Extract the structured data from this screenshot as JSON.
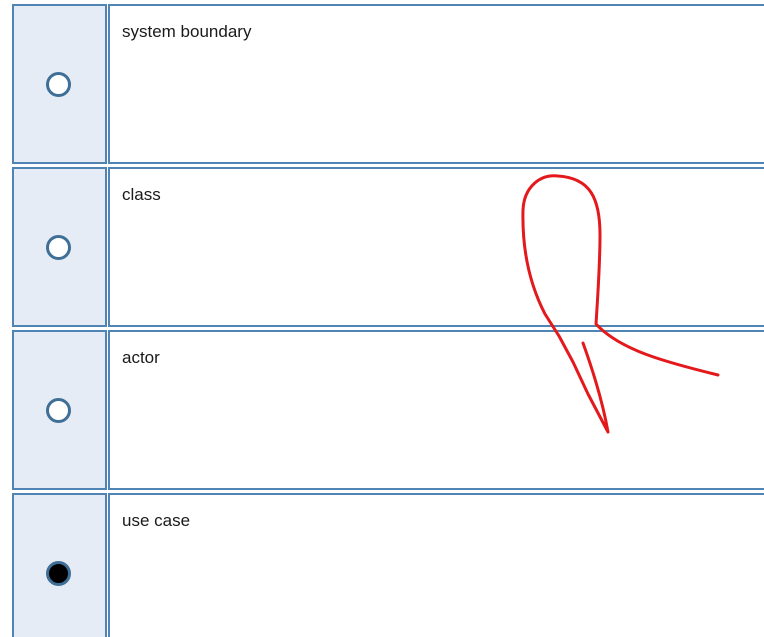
{
  "question": {
    "options": [
      {
        "label": "system boundary",
        "selected": false
      },
      {
        "label": "class",
        "selected": false
      },
      {
        "label": "actor",
        "selected": false
      },
      {
        "label": "use case",
        "selected": true
      }
    ]
  },
  "annotation": {
    "color": "#e3191c"
  }
}
